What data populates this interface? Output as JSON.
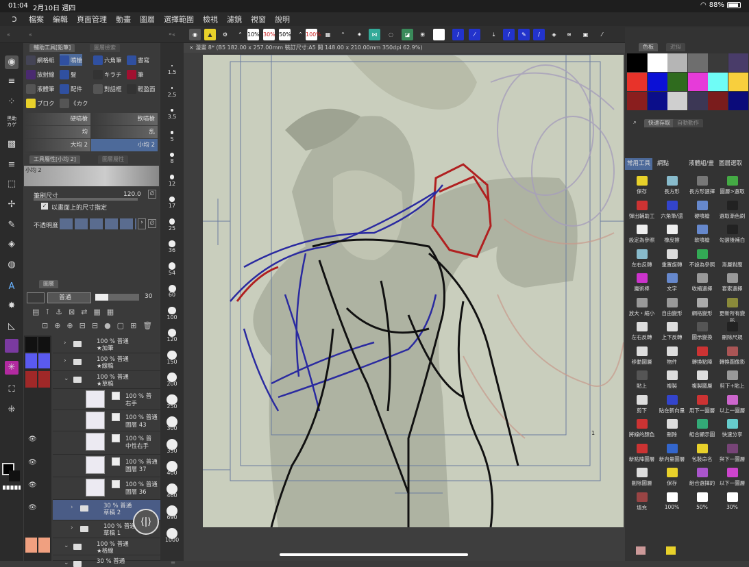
{
  "status": {
    "time": "01:04",
    "date": "2月10日 週四",
    "battery": "88%",
    "battery_level": 0.88
  },
  "menu": [
    "檔案",
    "編輯",
    "頁面管理",
    "動畫",
    "圖層",
    "選擇範圍",
    "檢視",
    "濾鏡",
    "視窗",
    "說明"
  ],
  "cmdbar": {
    "zoom_buttons": [
      "10%",
      "30%",
      "50%",
      "100%"
    ]
  },
  "canvas": {
    "tab_title": "漫畫 8* (B5 182.00 x 257.00mm 裝訂尺寸:A5 開 148.00 x 210.00mm 350dpi 62.9%)",
    "page_number": "1"
  },
  "subtool": {
    "tabs": [
      "輔助工具[鉛筆]",
      "圖層檢索"
    ],
    "items": [
      [
        "網格紙",
        "噴槍",
        "六角筆",
        "書寫"
      ],
      [
        "放射線",
        "髮",
        "キラチ",
        "筆"
      ],
      [
        "液體筆",
        "配件",
        "對話框",
        "輕盈面"
      ],
      [
        "ブロク",
        "《カク"
      ]
    ],
    "brushes": [
      [
        "硬噴槍",
        "軟噴槍"
      ],
      [
        "均",
        "乱"
      ],
      [
        "大均 2",
        "小均 2"
      ]
    ]
  },
  "toolprop": {
    "tabs": [
      "工具屬性[小均 2]",
      "圖層屬性"
    ],
    "brush_name": "小均 2",
    "brush_size_label": "筆刷尺寸",
    "brush_size_value": "120.0",
    "checkbox_label": "以畫面上的尺寸指定",
    "opacity_label": "不透明度"
  },
  "layers": {
    "tab": "圖層",
    "blend_mode": "普通",
    "opacity": "30",
    "rows": [
      {
        "pct": "100 % 普通",
        "name": "★加筆",
        "type": "folder"
      },
      {
        "pct": "100 % 普通",
        "name": "★線稿",
        "type": "folder"
      },
      {
        "pct": "100 % 普通",
        "name": "★草稿",
        "type": "folder"
      },
      {
        "pct": "100 % 普",
        "name": "右手",
        "type": "layer"
      },
      {
        "pct": "100 % 普通",
        "name": "圖層 43",
        "type": "layer"
      },
      {
        "pct": "100 % 普",
        "name": "中性右手",
        "type": "layer"
      },
      {
        "pct": "100 % 普通",
        "name": "圖層 37",
        "type": "layer"
      },
      {
        "pct": "100 % 普通",
        "name": "圖層 36",
        "type": "layer"
      },
      {
        "pct": "30 % 普通",
        "name": "草稿 2",
        "type": "folder"
      },
      {
        "pct": "100 % 普通",
        "name": "草稿 1",
        "type": "folder"
      },
      {
        "pct": "100 % 普通",
        "name": "★格線",
        "type": "folder"
      },
      {
        "pct": "30 % 普通",
        "name": "",
        "type": "folder"
      }
    ]
  },
  "brush_sizes": [
    "1.5",
    "2.5",
    "3.5",
    "5",
    "8",
    "12",
    "17",
    "25",
    "36",
    "54",
    "60",
    "100",
    "120",
    "150",
    "200",
    "250",
    "300",
    "350",
    "400",
    "460",
    "690",
    "1000"
  ],
  "palette": {
    "tabs": [
      "色板",
      "近似"
    ],
    "colors": [
      "#000000",
      "#ffffff",
      "#b5b5b5",
      "#6e6e6e",
      "#3a3a3a",
      "#493c69",
      "#e8332a",
      "#0b10d6",
      "#2f6b1e",
      "#e63bd9",
      "#6ffcf6",
      "#f8cf3d",
      "#8a1e1e",
      "#0b0e8a",
      "#cfcfcf",
      "#3c3755",
      "#7a1c1c",
      "#0b0b7a"
    ]
  },
  "quick": {
    "tabs": [
      "快速存取",
      "自動動作"
    ],
    "subtabs": [
      "常用工具",
      "網點",
      "液體組/畫",
      "圖層選取"
    ],
    "actions": [
      "保存",
      "長方形",
      "長方形選擇",
      "圖層>選取",
      "彈出輔助工",
      "六角筆/還",
      "硬噴槍",
      "選取漸色刷",
      "設定為參照",
      "橡皮擦",
      "軟噴槍",
      "勾選後補白",
      "左右反轉",
      "重置旋轉",
      "不設為參照",
      "漸層對應",
      "魔術棒",
      "文字",
      "收縮選擇",
      "套索選擇",
      "放大・縮小",
      "自由變形",
      "網格變形",
      "更新所有變形",
      "左右反轉",
      "上下反轉",
      "圖示變換",
      "刪除尺規",
      "移動圖層",
      "物件",
      "轉換點陣",
      "轉換圖像影",
      "貼上",
      "複製",
      "複製圖層",
      "剪下+貼上",
      "剪下",
      "貼在新向量",
      "用下一圖層",
      "以上一圖層",
      "將線的顏色",
      "刪除",
      "組合顯示圖",
      "快速分享",
      "新點陣圖層",
      "新向量圖層",
      "包裝命名",
      "與下一圖層",
      "刪除圖層",
      "保存",
      "組合選擇的",
      "以下一圖層",
      "填充",
      "100%",
      "50%",
      "30%"
    ]
  }
}
